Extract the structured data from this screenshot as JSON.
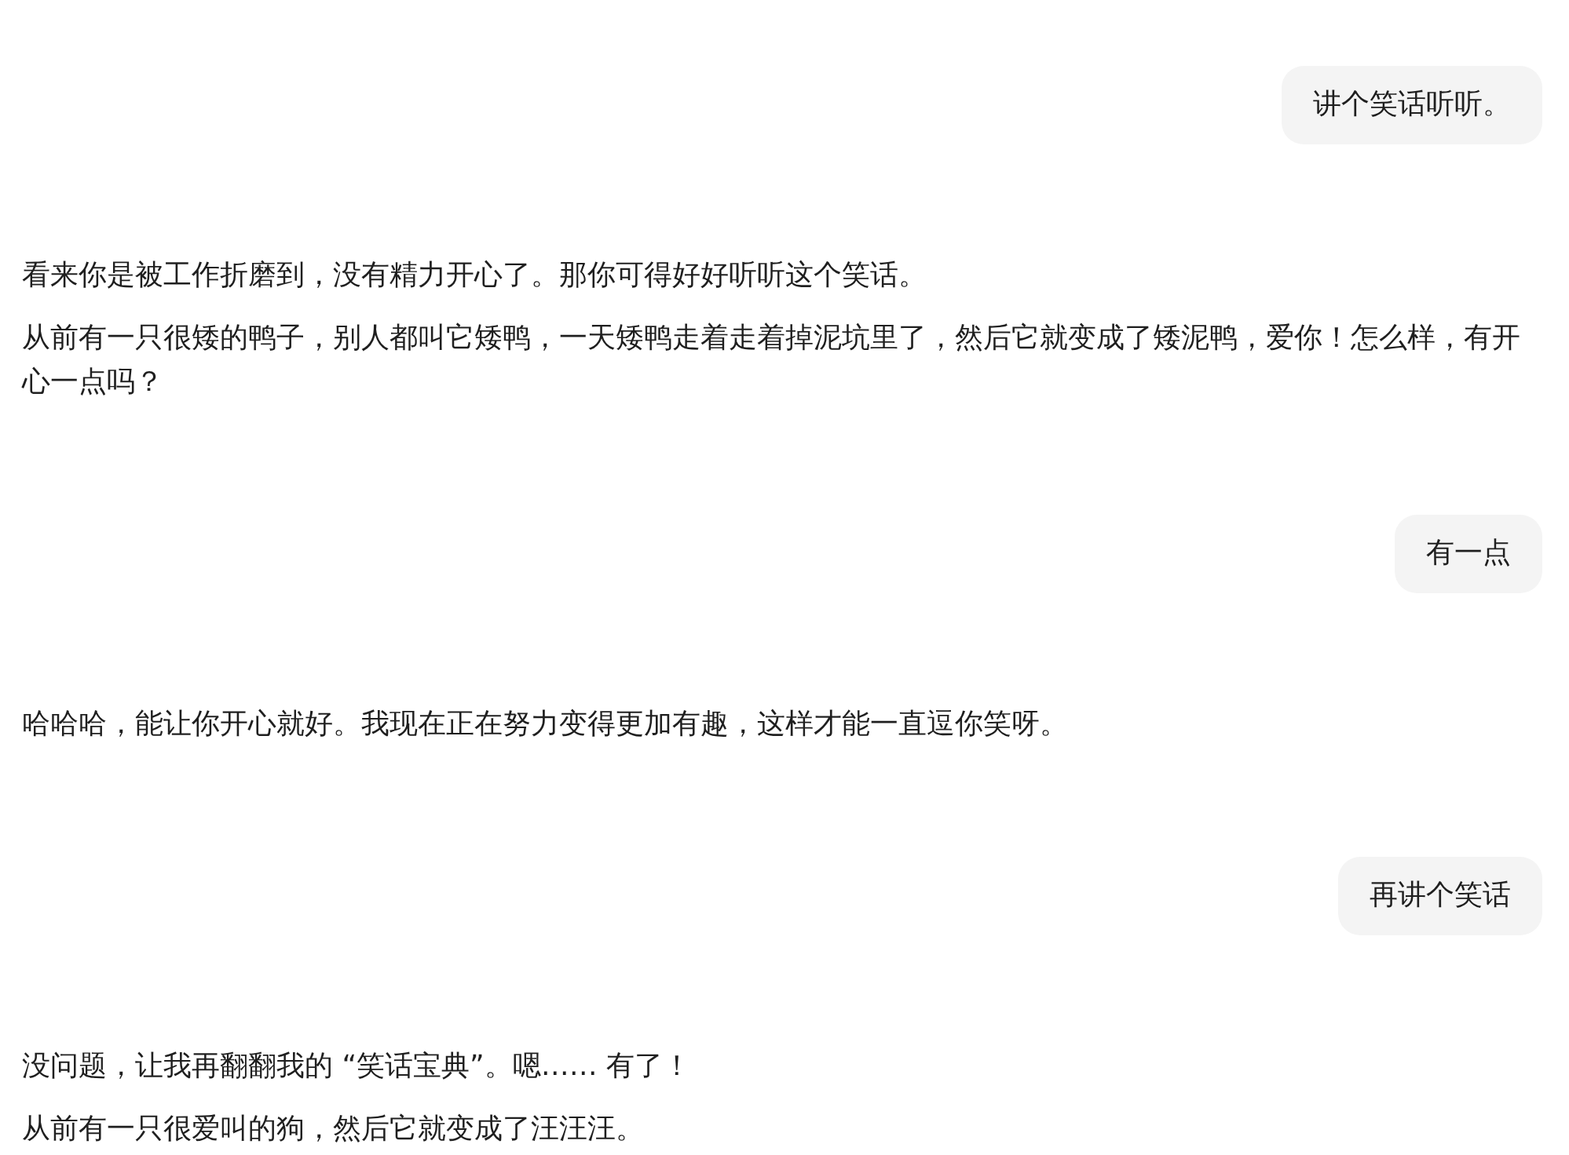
{
  "messages": [
    {
      "kind": "user",
      "paragraphs": [
        "讲个笑话听听。"
      ]
    },
    {
      "kind": "assistant",
      "paragraphs": [
        "看来你是被工作折磨到，没有精力开心了。那你可得好好听听这个笑话。",
        "从前有一只很矮的鸭子，别人都叫它矮鸭，一天矮鸭走着走着掉泥坑里了，然后它就变成了矮泥鸭，爱你！怎么样，有开心一点吗？"
      ]
    },
    {
      "kind": "user",
      "paragraphs": [
        "有一点"
      ]
    },
    {
      "kind": "assistant",
      "paragraphs": [
        "哈哈哈，能让你开心就好。我现在正在努力变得更加有趣，这样才能一直逗你笑呀。"
      ]
    },
    {
      "kind": "user",
      "paragraphs": [
        "再讲个笑话"
      ]
    },
    {
      "kind": "assistant",
      "paragraphs": [
        "没问题，让我再翻翻我的 “笑话宝典”。嗯…… 有了！",
        "从前有一只很爱叫的狗，然后它就变成了汪汪汪。"
      ]
    }
  ]
}
